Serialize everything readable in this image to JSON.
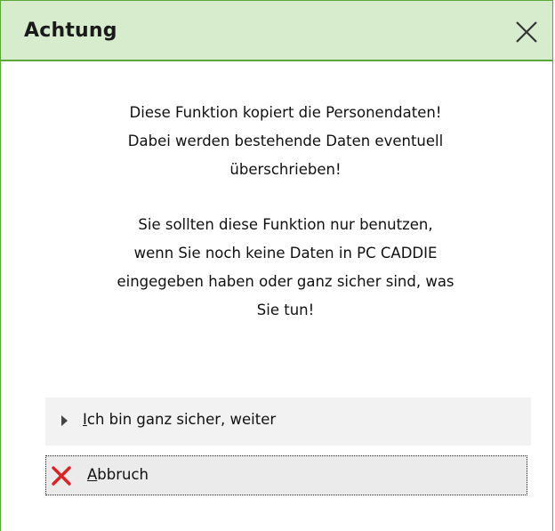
{
  "dialog": {
    "title": "Achtung",
    "message_paragraph_1": [
      "Diese Funktion kopiert die Personendaten!",
      "Dabei werden bestehende Daten eventuell",
      "überschrieben!"
    ],
    "message_paragraph_2": [
      "Sie sollten diese Funktion nur benutzen,",
      "wenn Sie noch keine Daten in PC CADDIE",
      "eingegeben haben oder ganz sicher sind, was",
      "Sie tun!"
    ]
  },
  "buttons": {
    "confirm": {
      "hotkey_char": "I",
      "label_rest": "ch bin ganz sicher, weiter",
      "icon": "triangle-right-icon"
    },
    "abort": {
      "hotkey_char": "A",
      "label_rest": "bbruch",
      "icon": "red-x-icon"
    }
  },
  "colors": {
    "titlebar_bg": "#d6eccd",
    "border_accent": "#5aa83a",
    "abort_icon": "#e02020"
  }
}
